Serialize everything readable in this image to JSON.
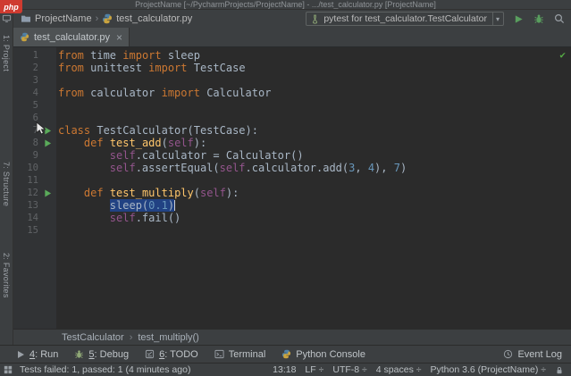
{
  "badge": {
    "label": "php"
  },
  "title_bar": {
    "text": "ProjectName [~/PycharmProjects/ProjectName] - .../test_calculator.py [ProjectName]"
  },
  "nav_bar": {
    "project": "ProjectName",
    "separator": "›",
    "file": "test_calculator.py",
    "run_config": "pytest for test_calculator.TestCalculator",
    "combo_arrow": "▾"
  },
  "editor_tabs": [
    {
      "label": "test_calculator.py",
      "close": "×"
    }
  ],
  "left_stripe": {
    "items": [
      {
        "label": "1: Project"
      },
      {
        "label": "7: Structure"
      },
      {
        "label": "2: Favorites"
      }
    ]
  },
  "editor": {
    "inspection_status": "✔",
    "lines": [
      {
        "n": "1",
        "segs": [
          [
            "kw",
            "from"
          ],
          [
            "pl",
            " time "
          ],
          [
            "kw",
            "import"
          ],
          [
            "pl",
            " sleep"
          ]
        ]
      },
      {
        "n": "2",
        "segs": [
          [
            "kw",
            "from"
          ],
          [
            "pl",
            " unittest "
          ],
          [
            "kw",
            "import"
          ],
          [
            "pl",
            " TestCase"
          ]
        ]
      },
      {
        "n": "3",
        "segs": []
      },
      {
        "n": "4",
        "segs": [
          [
            "kw",
            "from"
          ],
          [
            "pl",
            " calculator "
          ],
          [
            "kw",
            "import"
          ],
          [
            "pl",
            " Calculator"
          ]
        ]
      },
      {
        "n": "5",
        "segs": []
      },
      {
        "n": "6",
        "segs": []
      },
      {
        "n": "7",
        "icon": "run",
        "segs": [
          [
            "kw",
            "class"
          ],
          [
            "pl",
            " TestCalculator(TestCase):"
          ]
        ]
      },
      {
        "n": "8",
        "icon": "run",
        "segs": [
          [
            "pl",
            "    "
          ],
          [
            "kw",
            "def"
          ],
          [
            "pl",
            " "
          ],
          [
            "fn",
            "test_add"
          ],
          [
            "pl",
            "("
          ],
          [
            "slf",
            "self"
          ],
          [
            "pl",
            "):"
          ]
        ]
      },
      {
        "n": "9",
        "segs": [
          [
            "pl",
            "        "
          ],
          [
            "slf",
            "self"
          ],
          [
            "pl",
            ".calculator = Calculator()"
          ]
        ]
      },
      {
        "n": "10",
        "segs": [
          [
            "pl",
            "        "
          ],
          [
            "slf",
            "self"
          ],
          [
            "pl",
            ".assertEqual("
          ],
          [
            "slf",
            "self"
          ],
          [
            "pl",
            ".calculator.add("
          ],
          [
            "num",
            "3"
          ],
          [
            "pl",
            ", "
          ],
          [
            "num",
            "4"
          ],
          [
            "pl",
            "), "
          ],
          [
            "num",
            "7"
          ],
          [
            "pl",
            ")"
          ]
        ]
      },
      {
        "n": "11",
        "segs": []
      },
      {
        "n": "12",
        "icon": "run",
        "segs": [
          [
            "pl",
            "    "
          ],
          [
            "kw",
            "def"
          ],
          [
            "pl",
            " "
          ],
          [
            "fn",
            "test_multiply"
          ],
          [
            "pl",
            "("
          ],
          [
            "slf",
            "self"
          ],
          [
            "pl",
            "):"
          ]
        ]
      },
      {
        "n": "13",
        "caret": true,
        "segs": [
          [
            "pl",
            "        "
          ],
          [
            "pl sel",
            "sleep("
          ],
          [
            "num sel",
            "0.1"
          ],
          [
            "pl sel",
            ")"
          ]
        ]
      },
      {
        "n": "14",
        "segs": [
          [
            "pl",
            "        "
          ],
          [
            "slf",
            "self"
          ],
          [
            "pl",
            ".fail()"
          ]
        ]
      },
      {
        "n": "15",
        "segs": []
      }
    ]
  },
  "breadcrumb_bar": {
    "class": "TestCalculator",
    "separator": "›",
    "method": "test_multiply()"
  },
  "bottom_bar": {
    "left_items": [
      {
        "icon": "run-icon",
        "mn": "4",
        "rest": ": Run"
      },
      {
        "icon": "debug-icon",
        "mn": "5",
        "rest": ": Debug"
      },
      {
        "icon": "todo-icon",
        "mn": "6",
        "rest": ": TODO"
      },
      {
        "icon": "terminal-icon",
        "mn": "",
        "rest": "Terminal"
      },
      {
        "icon": "python-console-icon",
        "mn": "",
        "rest": "Python Console"
      }
    ],
    "event_log": "Event Log"
  },
  "status_bar": {
    "message": "Tests failed: 1, passed: 1 (4 minutes ago)",
    "items": [
      "13:18",
      "LF ÷",
      "UTF-8 ÷",
      "4 spaces ÷",
      "Python 3.6 (ProjectName) ÷"
    ]
  },
  "colors": {
    "keyword": "#cc7832",
    "function": "#ffc66b",
    "self_kw": "#94558d",
    "number": "#6897bb",
    "text": "#a9b7c6",
    "selection": "#214283",
    "run_green": "#5aab5a"
  }
}
